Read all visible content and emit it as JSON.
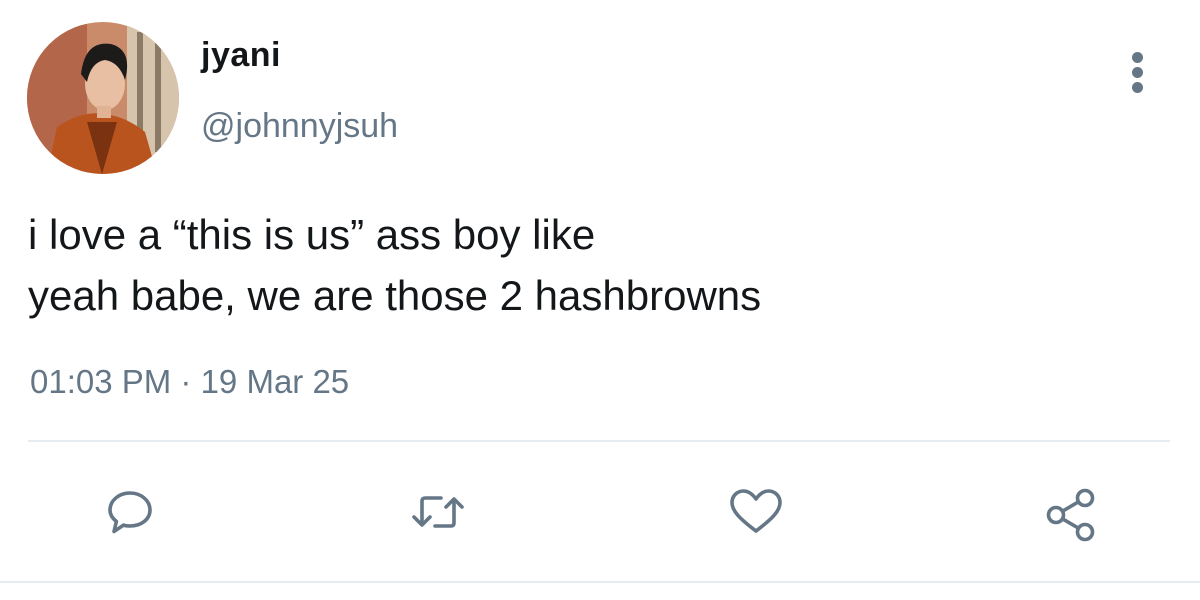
{
  "user": {
    "display_name": "jyani",
    "handle": "@johnnyjsuh"
  },
  "tweet": {
    "lines": [
      "i love a “this is us” ass boy like",
      "yeah babe, we are those 2 hashbrowns"
    ],
    "timestamp": "01:03 PM · 19 Mar 25"
  },
  "actions": [
    {
      "icon": "reply-icon"
    },
    {
      "icon": "retweet-icon"
    },
    {
      "icon": "like-icon"
    },
    {
      "icon": "share-icon"
    }
  ],
  "colors": {
    "text_primary": "#14171a",
    "text_secondary": "#657786",
    "divider": "#e6ecf0"
  }
}
